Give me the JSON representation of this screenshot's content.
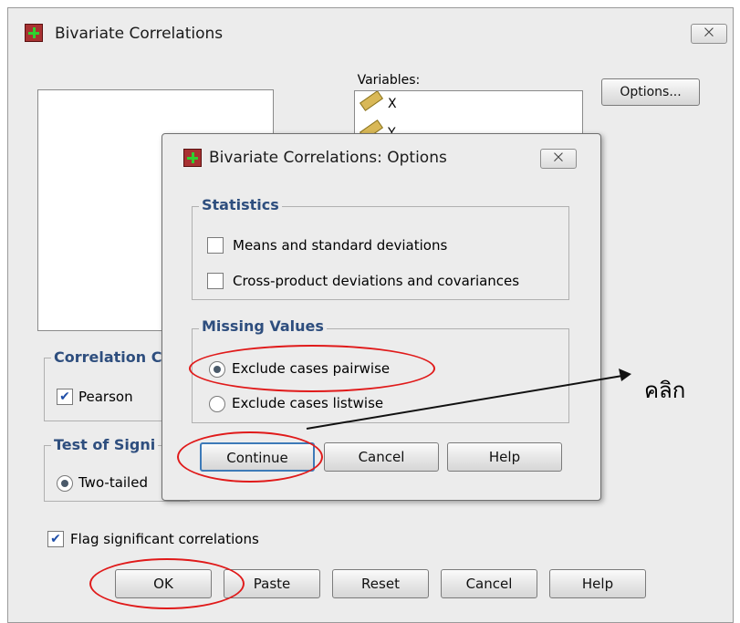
{
  "main_window": {
    "title": "Bivariate Correlations",
    "close_label": "⨉",
    "variables_label": "Variables:",
    "variables": [
      "X",
      "Y"
    ],
    "options_button": "Options...",
    "correlation_group_title": "Correlation C",
    "pearson_label": "Pearson",
    "test_group_title": "Test of Signi",
    "two_tailed_label": "Two-tailed",
    "flag_label": "Flag significant correlations",
    "buttons": {
      "ok": "OK",
      "paste": "Paste",
      "reset": "Reset",
      "cancel": "Cancel",
      "help": "Help"
    }
  },
  "options_dialog": {
    "title": "Bivariate Correlations: Options",
    "close_label": "⨉",
    "statistics_title": "Statistics",
    "means_label": "Means and standard deviations",
    "crossprod_label": "Cross-product deviations and covariances",
    "missing_title": "Missing Values",
    "pairwise_label": "Exclude cases pairwise",
    "listwise_label": "Exclude cases listwise",
    "buttons": {
      "continue": "Continue",
      "cancel": "Cancel",
      "help": "Help"
    }
  },
  "annotation": {
    "text": "คลิก",
    "color": "#e01a1a"
  }
}
